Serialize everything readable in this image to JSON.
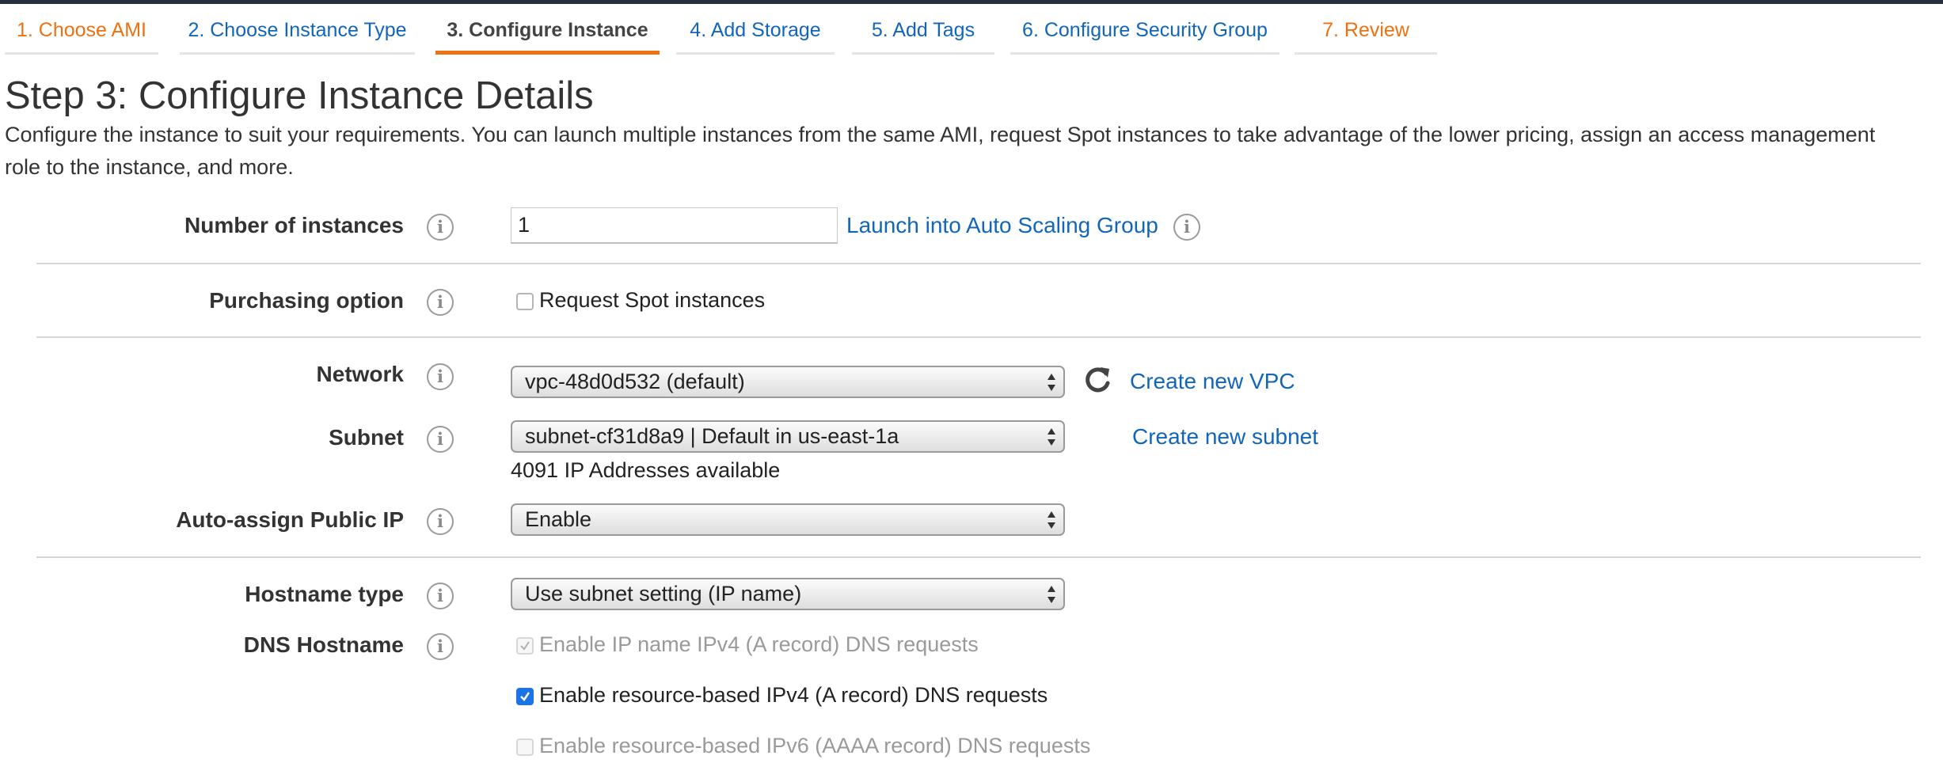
{
  "wizard_tabs": [
    {
      "label": "1. Choose AMI",
      "state": "done"
    },
    {
      "label": "2. Choose Instance Type",
      "state": "todo"
    },
    {
      "label": "3. Configure Instance",
      "state": "active"
    },
    {
      "label": "4. Add Storage",
      "state": "todo"
    },
    {
      "label": "5. Add Tags",
      "state": "todo"
    },
    {
      "label": "6. Configure Security Group",
      "state": "todo"
    },
    {
      "label": "7. Review",
      "state": "done"
    }
  ],
  "page": {
    "title": "Step 3: Configure Instance Details",
    "description": "Configure the instance to suit your requirements. You can launch multiple instances from the same AMI, request Spot instances to take advantage of the lower pricing, assign an access management role to the instance, and more."
  },
  "form": {
    "instances": {
      "label": "Number of instances",
      "value": "1",
      "asg_link": "Launch into Auto Scaling Group"
    },
    "purchasing": {
      "label": "Purchasing option",
      "spot_label": "Request Spot instances",
      "spot_checked": false
    },
    "network": {
      "label": "Network",
      "value": "vpc-48d0d532 (default)",
      "create_link": "Create new VPC"
    },
    "subnet": {
      "label": "Subnet",
      "value": "subnet-cf31d8a9 | Default in us-east-1a",
      "create_link": "Create new subnet",
      "available": "4091 IP Addresses available"
    },
    "public_ip": {
      "label": "Auto-assign Public IP",
      "value": "Enable"
    },
    "hostname_type": {
      "label": "Hostname type",
      "value": "Use subnet setting (IP name)"
    },
    "dns_hostname": {
      "label": "DNS Hostname",
      "options": [
        {
          "label": "Enable IP name IPv4 (A record) DNS requests",
          "checked": true,
          "disabled": true
        },
        {
          "label": "Enable resource-based IPv4 (A record) DNS requests",
          "checked": true,
          "disabled": false
        },
        {
          "label": "Enable resource-based IPv6 (AAAA record) DNS requests",
          "checked": false,
          "disabled": true
        }
      ]
    }
  },
  "icons": {
    "info": "info-icon",
    "refresh": "refresh-icon",
    "select_arrows": "select-arrows-icon",
    "check": "checkmark-icon"
  },
  "colors": {
    "accent_orange": "#ec7211",
    "link_blue": "#1166bb",
    "checkbox_blue": "#1a73e8",
    "header_dark": "#232f3e"
  }
}
